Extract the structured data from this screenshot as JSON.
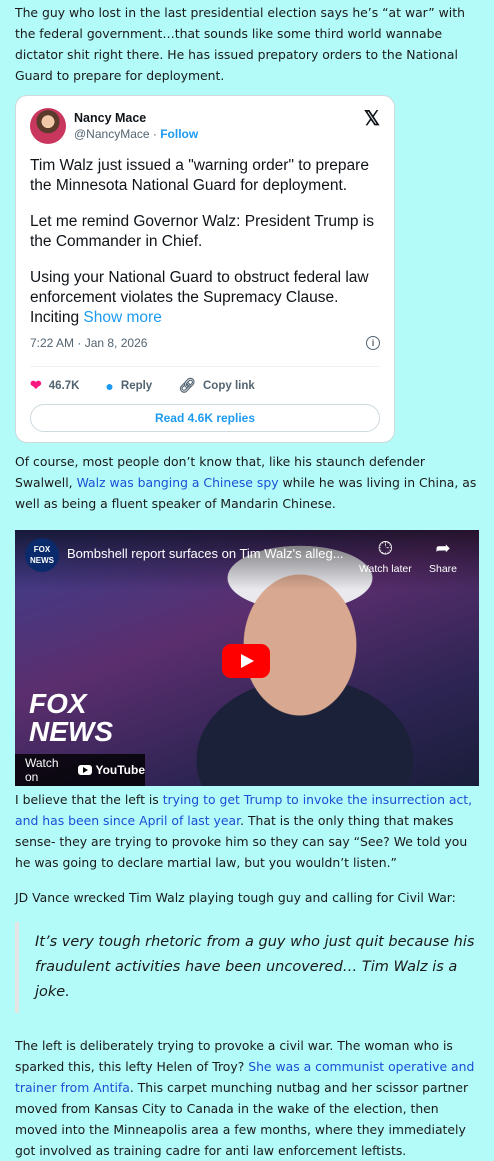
{
  "para1": "The guy who lost in the last presidential election says he’s “at war” with the federal government…that sounds like some third world wannabe dictator shit right there. He has issued prepatory orders to the National Guard to prepare for deployment.",
  "tweet": {
    "name": "Nancy Mace",
    "handle": "@NancyMace",
    "sep": " · ",
    "follow": "Follow",
    "x_logo": "𝕏",
    "line1": "Tim Walz just issued a \"warning order\" to prepare the Minnesota National Guard for deployment.",
    "line2": "Let me remind Governor Walz: President Trump is the Commander in Chief.",
    "line3": "Using your National Guard to obstruct federal law enforcement violates the Supremacy Clause. Inciting",
    "show_more": " Show more",
    "timestamp": "7:22 AM · Jan 8, 2026",
    "likes": "46.7K",
    "reply_label": "Reply",
    "copy_label": "Copy link",
    "read_replies": "Read 4.6K replies"
  },
  "para2": {
    "before": "Of course, most people don’t know that, like his staunch defender Swalwell, ",
    "link": "Walz was banging a Chinese spy",
    "after": " while he was living in China, as well as being a fluent speaker of Mandarin Chinese."
  },
  "video": {
    "channel_badge": "FOX NEWS",
    "title": "Bombshell report surfaces on Tim Walz's alleg...",
    "watch_later": "Watch later",
    "share": "Share",
    "fox_logo_line1": "FOX",
    "fox_logo_line2": "NEWS",
    "watch_on": "Watch on",
    "youtube": "YouTube"
  },
  "para3": {
    "before": "I believe that the left is ",
    "link": "trying to get Trump to invoke the insurrection act, and has been since April of last year",
    "after": ". That is the only thing that makes sense- they are trying to provoke him so they can say “See? We told you he was going to declare martial law, but you wouldn’t listen.”"
  },
  "para4": "JD Vance wrecked Tim Walz playing tough guy and calling for Civil War:",
  "quote": "It’s very tough rhetoric from a guy who just quit because his fraudulent activities have been uncovered… Tim Walz is a joke.",
  "para5": {
    "before": "The left is deliberately trying to provoke a civil war. The woman who is sparked this, this lefty Helen of Troy? ",
    "link": "She was a communist operative and trainer from Antifa",
    "after": ". This carpet munching nutbag and her scissor partner moved from Kansas City to Canada in the wake of the election, then moved into the Minneapolis area a few months, where they immediately got involved as training cadre for anti law enforcement leftists."
  }
}
